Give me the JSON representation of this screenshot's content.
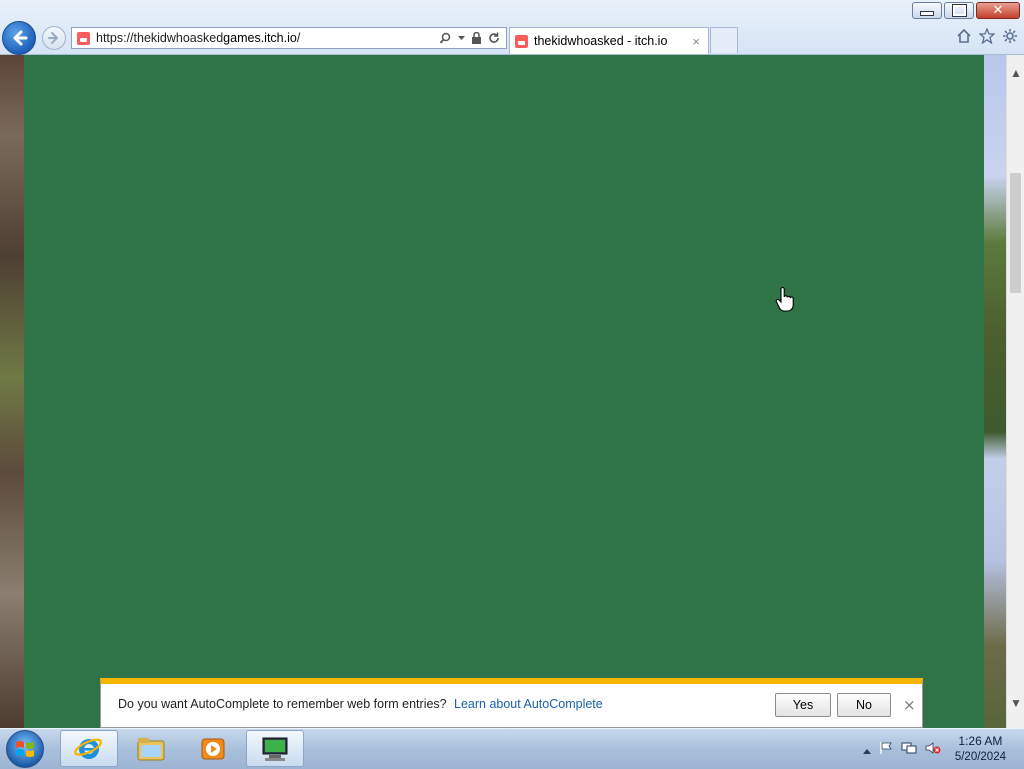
{
  "browser": {
    "url_prefix": "https://thekidwhoasked",
    "url_host": "games.itch.io",
    "url_suffix": "/",
    "tab_title": "thekidwhoasked - itch.io",
    "tab_close": "×"
  },
  "window_controls": {
    "close_glyph": "✕"
  },
  "notification": {
    "message": "Do you want AutoComplete to remember web form entries?",
    "link": "Learn about AutoComplete",
    "yes": "Yes",
    "no": "No",
    "close": "×"
  },
  "scroll": {
    "up": "▲",
    "down": "▼"
  },
  "taskbar": {
    "time": "1:26 AM",
    "date": "5/20/2024"
  },
  "colors": {
    "game_background": "#2f7446",
    "notification_accent": "#f5b400",
    "link": "#1c5fa8"
  },
  "icons": [
    "back-icon",
    "forward-icon",
    "search-icon",
    "lock-icon",
    "refresh-icon",
    "home-icon",
    "favorites-icon",
    "gear-icon",
    "windows-logo-icon",
    "ie-icon",
    "explorer-icon",
    "media-player-icon",
    "computer-icon",
    "flag-icon",
    "network-icon",
    "volume-muted-icon",
    "hand-cursor-icon"
  ]
}
